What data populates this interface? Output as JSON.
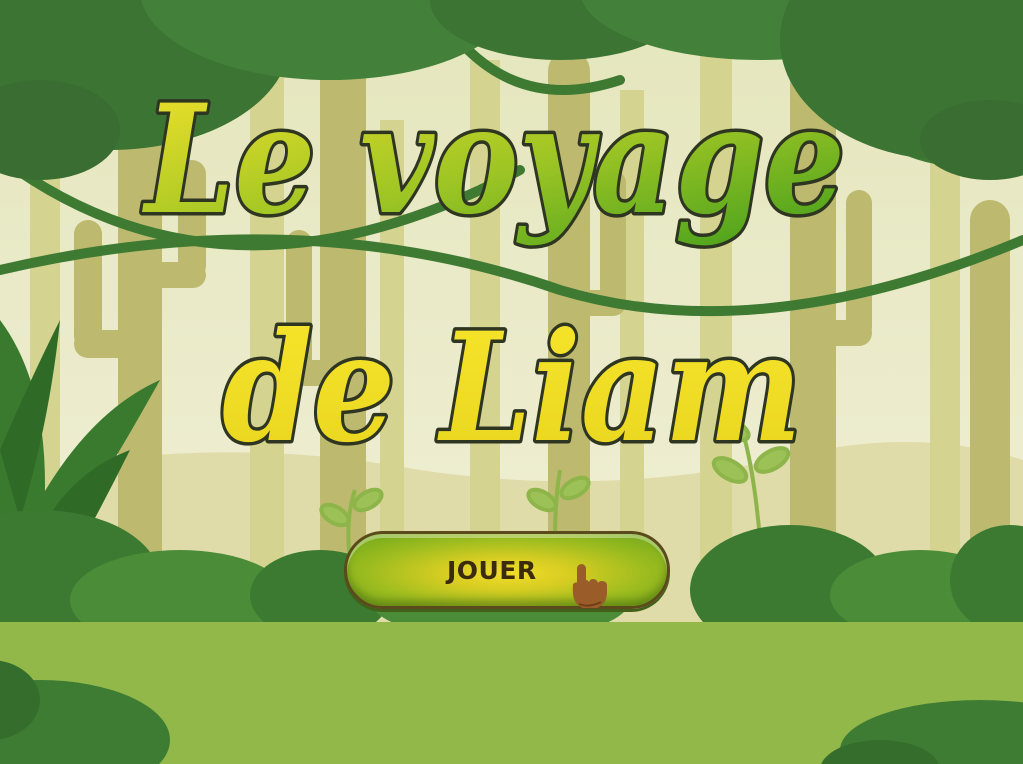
{
  "title": {
    "line1": "Le voyage",
    "line2": "de Liam"
  },
  "play_button": {
    "label": "JOUER",
    "icon": "pointing-hand-icon"
  },
  "colors": {
    "sky": "#eef0d2",
    "trunk": "#b9b66e",
    "canopy_dark": "#3a6d31",
    "canopy_mid": "#4b8a39",
    "ground": "#93b84a",
    "title_yellow": "#f4e22a",
    "title_green": "#4fa51a",
    "title_outline": "#2e3521",
    "button_yellow": "#f2dc2a",
    "button_green": "#6aa51c"
  }
}
